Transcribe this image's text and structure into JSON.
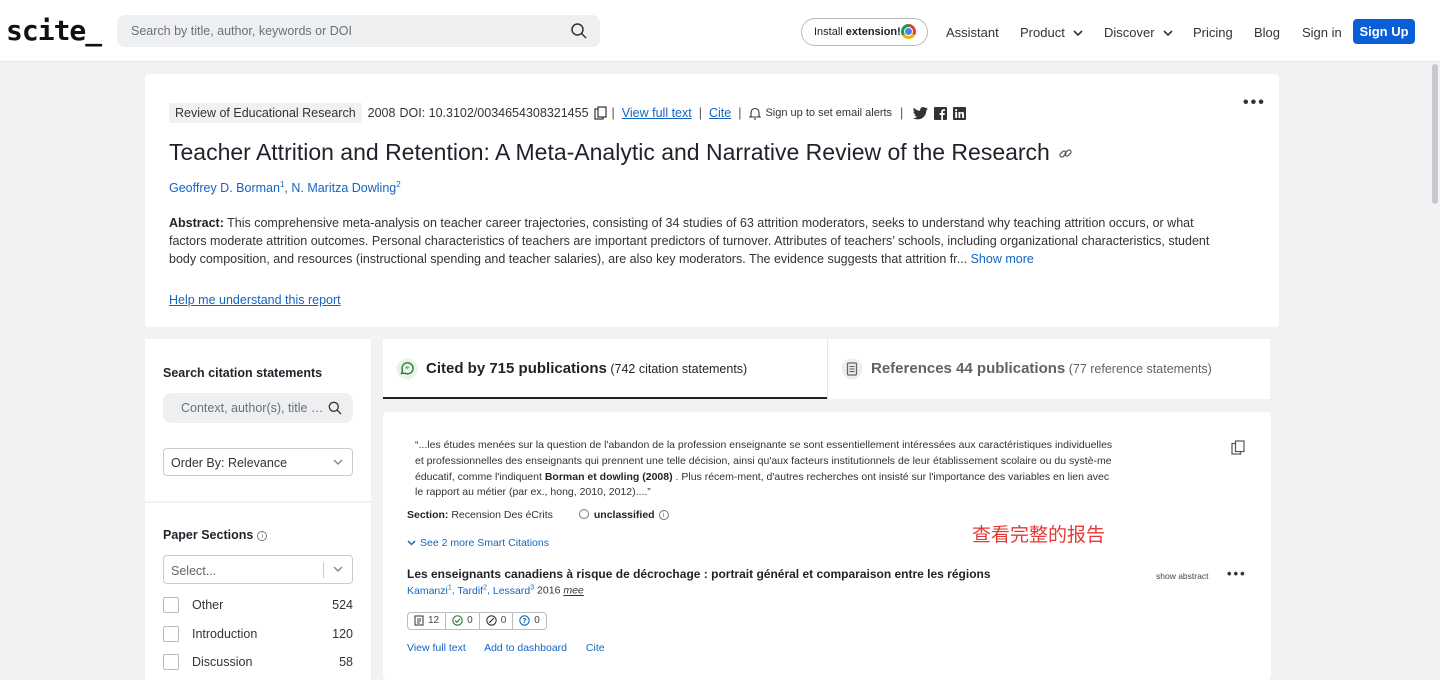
{
  "nav": {
    "logo": "scite_",
    "search_placeholder": "Search by title, author, keywords or DOI",
    "install_prefix": "Install ",
    "install_bold": "extension!",
    "assistant": "Assistant",
    "product": "Product",
    "discover": "Discover",
    "pricing": "Pricing",
    "blog": "Blog",
    "sign_in": "Sign in",
    "sign_up": "Sign Up"
  },
  "paper": {
    "journal": "Review of Educational Research",
    "year": "2008",
    "doi": "DOI: 10.3102/0034654308321455",
    "view_full_text": "View full text",
    "cite": "Cite",
    "alerts": "Sign up to set email alerts",
    "title": "Teacher Attrition and Retention: A Meta-Analytic and Narrative Review of the Research",
    "authors": [
      {
        "name": "Geoffrey D. Borman",
        "sup": "1"
      },
      {
        "name": "N. Maritza Dowling",
        "sup": "2"
      }
    ],
    "abstract_label": "Abstract:",
    "abstract_text": " This comprehensive meta-analysis on teacher career trajectories, consisting of 34 studies of 63 attrition moderators, seeks to understand why teaching attrition occurs, or what factors moderate attrition outcomes. Personal characteristics of teachers are important predictors of turnover. Attributes of teachers’ schools, including organizational characteristics, student body composition, and resources (instructional spending and teacher salaries), are also key moderators. The evidence suggests that attrition fr...",
    "show_more": " Show more",
    "help_link": "Help me understand this report"
  },
  "sidebar": {
    "search_label": "Search citation statements",
    "search_placeholder": "Context, author(s), title e...",
    "order_by": "Order By: Relevance",
    "sections_label": "Paper Sections",
    "select_placeholder": "Select...",
    "sections": [
      {
        "label": "Other",
        "count": "524"
      },
      {
        "label": "Introduction",
        "count": "120"
      },
      {
        "label": "Discussion",
        "count": "58"
      }
    ]
  },
  "tabs": {
    "cited_bold": "Cited by 715 publications",
    "cited_sub": " (742 citation statements)",
    "refs_bold": "References 44 publications",
    "refs_sub": " (77 reference statements)"
  },
  "citation": {
    "quote_before": "“...les études menées sur la question de l'abandon de la profession enseignante se sont essentiellement intéressées aux caractéristiques individuelles et professionnelles des enseignants qui prennent une telle décision, ainsi qu'aux facteurs institutionnels de leur établissement scolaire ou du systè-me éducatif, comme l'indiquent ",
    "quote_bold": "Borman et dowling (2008)",
    "quote_after": " . Plus récem-ment, d'autres recherches ont insisté sur l'importance des variables en lien avec le rapport au métier (par ex., hong, 2010, 2012)....”",
    "section_label": "Section:",
    "section_value": " Recension Des éCrits",
    "classification": "unclassified",
    "smart_citations": "See 2 more Smart Citations",
    "annotation": "查看完整的报告",
    "pub_title": "Les enseignants canadiens à risque de décrochage : portrait général et comparaison entre les régions",
    "pub_authors": [
      {
        "name": "Kamanzi",
        "sup": "1"
      },
      {
        "name": "Tardif",
        "sup": "2"
      },
      {
        "name": "Lessard",
        "sup": "3"
      }
    ],
    "pub_year": "2016",
    "pub_venue": "mee",
    "show_abstract": "show abstract",
    "badges": [
      {
        "icon": "document-icon",
        "value": "12"
      },
      {
        "icon": "supporting-icon",
        "value": "0"
      },
      {
        "icon": "mentioning-icon",
        "value": "0"
      },
      {
        "icon": "contrasting-icon",
        "value": "0"
      }
    ],
    "actions": {
      "view_full_text": "View full text",
      "add_to_dashboard": "Add to dashboard",
      "cite": "Cite"
    }
  },
  "colors": {
    "primary_button": "#0a5ed8",
    "link": "#1565c0",
    "annotation": "#e53935"
  }
}
